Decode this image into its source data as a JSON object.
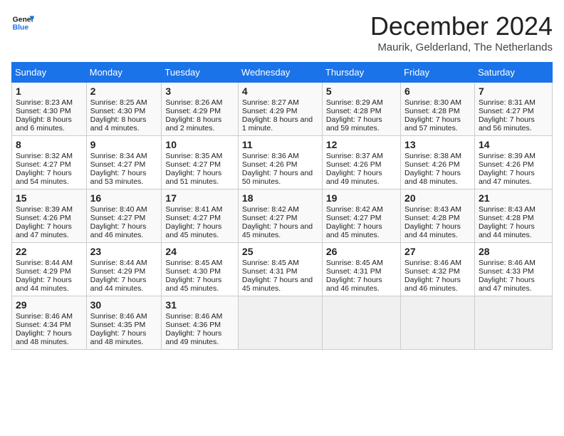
{
  "header": {
    "logo_line1": "General",
    "logo_line2": "Blue",
    "title": "December 2024",
    "subtitle": "Maurik, Gelderland, The Netherlands"
  },
  "days_of_week": [
    "Sunday",
    "Monday",
    "Tuesday",
    "Wednesday",
    "Thursday",
    "Friday",
    "Saturday"
  ],
  "weeks": [
    [
      {
        "day": 1,
        "sunrise": "8:23 AM",
        "sunset": "4:30 PM",
        "daylight": "8 hours and 6 minutes."
      },
      {
        "day": 2,
        "sunrise": "8:25 AM",
        "sunset": "4:30 PM",
        "daylight": "8 hours and 4 minutes."
      },
      {
        "day": 3,
        "sunrise": "8:26 AM",
        "sunset": "4:29 PM",
        "daylight": "8 hours and 2 minutes."
      },
      {
        "day": 4,
        "sunrise": "8:27 AM",
        "sunset": "4:29 PM",
        "daylight": "8 hours and 1 minute."
      },
      {
        "day": 5,
        "sunrise": "8:29 AM",
        "sunset": "4:28 PM",
        "daylight": "7 hours and 59 minutes."
      },
      {
        "day": 6,
        "sunrise": "8:30 AM",
        "sunset": "4:28 PM",
        "daylight": "7 hours and 57 minutes."
      },
      {
        "day": 7,
        "sunrise": "8:31 AM",
        "sunset": "4:27 PM",
        "daylight": "7 hours and 56 minutes."
      }
    ],
    [
      {
        "day": 8,
        "sunrise": "8:32 AM",
        "sunset": "4:27 PM",
        "daylight": "7 hours and 54 minutes."
      },
      {
        "day": 9,
        "sunrise": "8:34 AM",
        "sunset": "4:27 PM",
        "daylight": "7 hours and 53 minutes."
      },
      {
        "day": 10,
        "sunrise": "8:35 AM",
        "sunset": "4:27 PM",
        "daylight": "7 hours and 51 minutes."
      },
      {
        "day": 11,
        "sunrise": "8:36 AM",
        "sunset": "4:26 PM",
        "daylight": "7 hours and 50 minutes."
      },
      {
        "day": 12,
        "sunrise": "8:37 AM",
        "sunset": "4:26 PM",
        "daylight": "7 hours and 49 minutes."
      },
      {
        "day": 13,
        "sunrise": "8:38 AM",
        "sunset": "4:26 PM",
        "daylight": "7 hours and 48 minutes."
      },
      {
        "day": 14,
        "sunrise": "8:39 AM",
        "sunset": "4:26 PM",
        "daylight": "7 hours and 47 minutes."
      }
    ],
    [
      {
        "day": 15,
        "sunrise": "8:39 AM",
        "sunset": "4:26 PM",
        "daylight": "7 hours and 47 minutes."
      },
      {
        "day": 16,
        "sunrise": "8:40 AM",
        "sunset": "4:27 PM",
        "daylight": "7 hours and 46 minutes."
      },
      {
        "day": 17,
        "sunrise": "8:41 AM",
        "sunset": "4:27 PM",
        "daylight": "7 hours and 45 minutes."
      },
      {
        "day": 18,
        "sunrise": "8:42 AM",
        "sunset": "4:27 PM",
        "daylight": "7 hours and 45 minutes."
      },
      {
        "day": 19,
        "sunrise": "8:42 AM",
        "sunset": "4:27 PM",
        "daylight": "7 hours and 45 minutes."
      },
      {
        "day": 20,
        "sunrise": "8:43 AM",
        "sunset": "4:28 PM",
        "daylight": "7 hours and 44 minutes."
      },
      {
        "day": 21,
        "sunrise": "8:43 AM",
        "sunset": "4:28 PM",
        "daylight": "7 hours and 44 minutes."
      }
    ],
    [
      {
        "day": 22,
        "sunrise": "8:44 AM",
        "sunset": "4:29 PM",
        "daylight": "7 hours and 44 minutes."
      },
      {
        "day": 23,
        "sunrise": "8:44 AM",
        "sunset": "4:29 PM",
        "daylight": "7 hours and 44 minutes."
      },
      {
        "day": 24,
        "sunrise": "8:45 AM",
        "sunset": "4:30 PM",
        "daylight": "7 hours and 45 minutes."
      },
      {
        "day": 25,
        "sunrise": "8:45 AM",
        "sunset": "4:31 PM",
        "daylight": "7 hours and 45 minutes."
      },
      {
        "day": 26,
        "sunrise": "8:45 AM",
        "sunset": "4:31 PM",
        "daylight": "7 hours and 46 minutes."
      },
      {
        "day": 27,
        "sunrise": "8:46 AM",
        "sunset": "4:32 PM",
        "daylight": "7 hours and 46 minutes."
      },
      {
        "day": 28,
        "sunrise": "8:46 AM",
        "sunset": "4:33 PM",
        "daylight": "7 hours and 47 minutes."
      }
    ],
    [
      {
        "day": 29,
        "sunrise": "8:46 AM",
        "sunset": "4:34 PM",
        "daylight": "7 hours and 48 minutes."
      },
      {
        "day": 30,
        "sunrise": "8:46 AM",
        "sunset": "4:35 PM",
        "daylight": "7 hours and 48 minutes."
      },
      {
        "day": 31,
        "sunrise": "8:46 AM",
        "sunset": "4:36 PM",
        "daylight": "7 hours and 49 minutes."
      },
      null,
      null,
      null,
      null
    ]
  ]
}
